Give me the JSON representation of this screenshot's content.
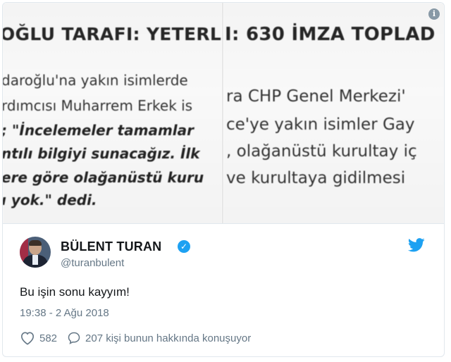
{
  "media": {
    "left": {
      "headline": "OĞLU TARAFI: YETERLİ S",
      "lines": [
        "daroğlu'na yakın isimlerde",
        "rdımcısı Muharrem Erkek is",
        "; \"İncelemeler tamamlar",
        "ntılı bilgiyi sunacağız. İlk",
        "ere göre olağanüstü kuru",
        "ı yok.\" dedi."
      ]
    },
    "right": {
      "headline": "I: 630 İMZA TOPLAD",
      "lines": [
        "ra CHP Genel Merkezi'",
        "ce'ye yakın isimler Gay",
        ", olağanüstü kurultay iç",
        "ve kurultaya gidilmesi"
      ]
    },
    "info_icon_glyph": "i"
  },
  "tweet": {
    "author_name": "BÜLENT TURAN",
    "handle": "@turanbulent",
    "text": "Bu işin sonu kayyım!",
    "timestamp": "19:38 - 2 Ağu 2018",
    "likes": "582",
    "conversation": "207 kişi bunun hakkında konuşuyor"
  },
  "colors": {
    "twitter_blue": "#1da1f2",
    "muted_text": "#657786",
    "border": "#e1e8ed"
  },
  "icons": [
    "info-icon",
    "verified-badge-icon",
    "twitter-bird-icon",
    "heart-icon",
    "reply-icon"
  ]
}
